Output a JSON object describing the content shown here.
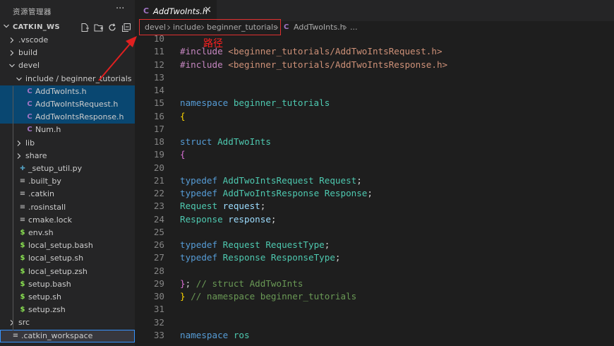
{
  "sidebar": {
    "title": "资源管理器",
    "more": "···",
    "workspace": "CATKIN_WS",
    "tree": [
      {
        "label": ".vscode",
        "type": "folder",
        "open": false,
        "depth": 0
      },
      {
        "label": "build",
        "type": "folder",
        "open": false,
        "depth": 0
      },
      {
        "label": "devel",
        "type": "folder",
        "open": true,
        "depth": 0
      },
      {
        "label": "include / beginner_tutorials",
        "type": "folder",
        "open": true,
        "depth": 1
      },
      {
        "label": "AddTwoInts.h",
        "type": "c",
        "depth": 2,
        "selected": true
      },
      {
        "label": "AddTwoIntsRequest.h",
        "type": "c",
        "depth": 2,
        "selected": true
      },
      {
        "label": "AddTwoIntsResponse.h",
        "type": "c",
        "depth": 2,
        "selected": true
      },
      {
        "label": "Num.h",
        "type": "c",
        "depth": 2
      },
      {
        "label": "lib",
        "type": "folder",
        "open": false,
        "depth": 1
      },
      {
        "label": "share",
        "type": "folder",
        "open": false,
        "depth": 1
      },
      {
        "label": "_setup_util.py",
        "type": "py",
        "depth": 1
      },
      {
        "label": ".built_by",
        "type": "txt",
        "depth": 1
      },
      {
        "label": ".catkin",
        "type": "txt",
        "depth": 1
      },
      {
        "label": ".rosinstall",
        "type": "txt",
        "depth": 1
      },
      {
        "label": "cmake.lock",
        "type": "txt",
        "depth": 1
      },
      {
        "label": "env.sh",
        "type": "sh",
        "depth": 1
      },
      {
        "label": "local_setup.bash",
        "type": "sh",
        "depth": 1
      },
      {
        "label": "local_setup.sh",
        "type": "sh",
        "depth": 1
      },
      {
        "label": "local_setup.zsh",
        "type": "sh",
        "depth": 1
      },
      {
        "label": "setup.bash",
        "type": "sh",
        "depth": 1
      },
      {
        "label": "setup.sh",
        "type": "sh",
        "depth": 1
      },
      {
        "label": "setup.zsh",
        "type": "sh",
        "depth": 1
      },
      {
        "label": "src",
        "type": "folder",
        "open": false,
        "depth": 0
      },
      {
        "label": ".catkin_workspace",
        "type": "txt",
        "depth": 0
      }
    ]
  },
  "tab": {
    "icon": "C",
    "label": "AddTwoInts.h",
    "close": "✕"
  },
  "breadcrumb": {
    "items": [
      "devel",
      "include",
      "beginner_tutorials"
    ],
    "file_icon": "C",
    "file": "AddTwoInts.h",
    "tail": "..."
  },
  "annotation": {
    "text": "路径"
  },
  "code": {
    "lines": [
      {
        "n": "10",
        "tokens": []
      },
      {
        "n": "11",
        "tokens": [
          [
            "kw-preproc",
            "#include "
          ],
          [
            "str",
            "<beginner_tutorials/AddTwoIntsRequest.h>"
          ]
        ]
      },
      {
        "n": "12",
        "tokens": [
          [
            "kw-preproc",
            "#include "
          ],
          [
            "str",
            "<beginner_tutorials/AddTwoIntsResponse.h>"
          ]
        ]
      },
      {
        "n": "13",
        "tokens": []
      },
      {
        "n": "14",
        "tokens": []
      },
      {
        "n": "15",
        "tokens": [
          [
            "kw",
            "namespace "
          ],
          [
            "ty",
            "beginner_tutorials"
          ]
        ]
      },
      {
        "n": "16",
        "tokens": [
          [
            "brace",
            "{"
          ]
        ]
      },
      {
        "n": "17",
        "tokens": []
      },
      {
        "n": "18",
        "tokens": [
          [
            "kw",
            "struct "
          ],
          [
            "ty",
            "AddTwoInts"
          ]
        ]
      },
      {
        "n": "19",
        "tokens": [
          [
            "brace2",
            "{"
          ]
        ]
      },
      {
        "n": "20",
        "tokens": []
      },
      {
        "n": "21",
        "tokens": [
          [
            "kw",
            "typedef "
          ],
          [
            "ty",
            "AddTwoIntsRequest "
          ],
          [
            "ty",
            "Request"
          ],
          [
            "plain",
            ";"
          ]
        ]
      },
      {
        "n": "22",
        "tokens": [
          [
            "kw",
            "typedef "
          ],
          [
            "ty",
            "AddTwoIntsResponse "
          ],
          [
            "ty",
            "Response"
          ],
          [
            "plain",
            ";"
          ]
        ]
      },
      {
        "n": "23",
        "tokens": [
          [
            "ty",
            "Request "
          ],
          [
            "var",
            "request"
          ],
          [
            "plain",
            ";"
          ]
        ]
      },
      {
        "n": "24",
        "tokens": [
          [
            "ty",
            "Response "
          ],
          [
            "var",
            "response"
          ],
          [
            "plain",
            ";"
          ]
        ]
      },
      {
        "n": "25",
        "tokens": []
      },
      {
        "n": "26",
        "tokens": [
          [
            "kw",
            "typedef "
          ],
          [
            "ty",
            "Request "
          ],
          [
            "ty",
            "RequestType"
          ],
          [
            "plain",
            ";"
          ]
        ]
      },
      {
        "n": "27",
        "tokens": [
          [
            "kw",
            "typedef "
          ],
          [
            "ty",
            "Response "
          ],
          [
            "ty",
            "ResponseType"
          ],
          [
            "plain",
            ";"
          ]
        ]
      },
      {
        "n": "28",
        "tokens": []
      },
      {
        "n": "29",
        "tokens": [
          [
            "brace2",
            "}"
          ],
          [
            "plain",
            "; "
          ],
          [
            "cmt",
            "// struct AddTwoInts"
          ]
        ]
      },
      {
        "n": "30",
        "tokens": [
          [
            "brace",
            "}"
          ],
          [
            "plain",
            " "
          ],
          [
            "cmt",
            "// namespace beginner_tutorials"
          ]
        ]
      },
      {
        "n": "31",
        "tokens": []
      },
      {
        "n": "32",
        "tokens": []
      },
      {
        "n": "33",
        "tokens": [
          [
            "kw",
            "namespace "
          ],
          [
            "ty",
            "ros"
          ]
        ]
      }
    ]
  },
  "colors": {
    "accent": "#094771",
    "annotation": "#e03030",
    "c_icon": "#a074c4",
    "sh_icon": "#89e051",
    "py_icon": "#519aba"
  }
}
